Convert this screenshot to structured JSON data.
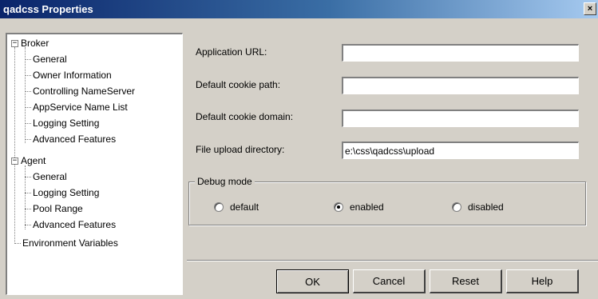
{
  "window": {
    "title": "qadcss Properties",
    "close_glyph": "×"
  },
  "tree": {
    "items": [
      {
        "label": "Broker",
        "level": 0,
        "expander": "−"
      },
      {
        "label": "General",
        "level": 1
      },
      {
        "label": "Owner Information",
        "level": 1
      },
      {
        "label": "Controlling NameServer",
        "level": 1
      },
      {
        "label": "AppService Name List",
        "level": 1
      },
      {
        "label": "Logging Setting",
        "level": 1
      },
      {
        "label": "Advanced Features",
        "level": 1
      },
      {
        "label": "Agent",
        "level": 0,
        "expander": "−"
      },
      {
        "label": "General",
        "level": 1
      },
      {
        "label": "Logging Setting",
        "level": 1
      },
      {
        "label": "Pool Range",
        "level": 1
      },
      {
        "label": "Advanced Features",
        "level": 1
      },
      {
        "label": "Environment Variables",
        "level": 0
      }
    ]
  },
  "form": {
    "app_url_label": "Application URL:",
    "app_url_value": "",
    "cookie_path_label": "Default cookie path:",
    "cookie_path_value": "",
    "cookie_domain_label": "Default cookie domain:",
    "cookie_domain_value": "",
    "upload_dir_label": "File upload directory:",
    "upload_dir_value": "e:\\css\\qadcss\\upload"
  },
  "debug": {
    "title": "Debug mode",
    "options": [
      "default",
      "enabled",
      "disabled"
    ],
    "selected": "enabled"
  },
  "buttons": {
    "ok": "OK",
    "cancel": "Cancel",
    "reset": "Reset",
    "help": "Help"
  }
}
